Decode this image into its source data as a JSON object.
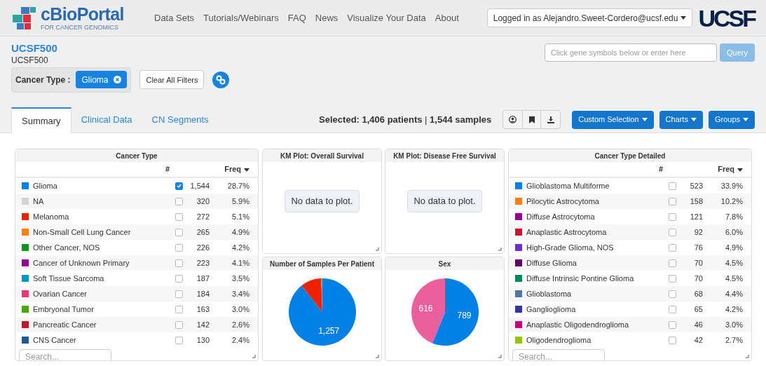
{
  "header": {
    "logo_title": "cBioPortal",
    "logo_subtitle": "FOR CANCER GENOMICS",
    "nav": [
      "Data Sets",
      "Tutorials/Webinars",
      "FAQ",
      "News",
      "Visualize Your Data",
      "About"
    ],
    "login": "Logged in as Alejandro.Sweet-Cordero@ucsf.edu",
    "brand": "UCSF"
  },
  "study": {
    "title": "UCSF500",
    "subtitle": "UCSF500",
    "filter_label": "Cancer Type :",
    "filters": [
      "Glioma"
    ],
    "clear_button": "Clear All Filters",
    "gene_query": {
      "placeholder": "Click gene symbols below or enter here"
    },
    "query_button": "Query"
  },
  "tabs": [
    {
      "label": "Summary",
      "selected": true
    },
    {
      "label": "Clinical Data",
      "selected": false
    },
    {
      "label": "CN Segments",
      "selected": false
    }
  ],
  "selection": {
    "label": "Selected:",
    "patients": "1,406 patients",
    "separator": "|",
    "samples": "1,544 samples"
  },
  "toolbar_buttons": [
    "Custom Selection",
    "Charts",
    "Groups"
  ],
  "tables": [
    {
      "title": "Cancer Type",
      "col_count": "#",
      "col_freq": "Freq",
      "search": {
        "placeholder": "Search..."
      },
      "rows": [
        {
          "name": "Glioma",
          "color": "#0280e6",
          "checked": true,
          "count": "1,544",
          "freq": "28.7%"
        },
        {
          "name": "NA",
          "color": "#d3d3d3",
          "checked": false,
          "count": "320",
          "freq": "5.9%"
        },
        {
          "name": "Melanoma",
          "color": "#ee2200",
          "checked": false,
          "count": "272",
          "freq": "5.1%"
        },
        {
          "name": "Non-Small Cell Lung Cancer",
          "color": "#ff7f0e",
          "checked": false,
          "count": "265",
          "freq": "4.9%"
        },
        {
          "name": "Other Cancer, NOS",
          "color": "#109618",
          "checked": false,
          "count": "226",
          "freq": "4.2%"
        },
        {
          "name": "Cancer of Unknown Primary",
          "color": "#990099",
          "checked": false,
          "count": "223",
          "freq": "4.1%"
        },
        {
          "name": "Soft Tissue Sarcoma",
          "color": "#0099c6",
          "checked": false,
          "count": "187",
          "freq": "3.5%"
        },
        {
          "name": "Ovarian Cancer",
          "color": "#ee3377",
          "checked": false,
          "count": "184",
          "freq": "3.4%"
        },
        {
          "name": "Embryonal Tumor",
          "color": "#44aa00",
          "checked": false,
          "count": "163",
          "freq": "3.0%"
        },
        {
          "name": "Pancreatic Cancer",
          "color": "#c4192a",
          "checked": false,
          "count": "142",
          "freq": "2.6%"
        },
        {
          "name": "CNS Cancer",
          "color": "#1c5c94",
          "checked": false,
          "count": "130",
          "freq": "2.4%"
        }
      ]
    },
    {
      "title": "Cancer Type Detailed",
      "col_count": "#",
      "col_freq": "Freq",
      "search": {
        "placeholder": "Search..."
      },
      "rows": [
        {
          "name": "Glioblastoma Multiforme",
          "color": "#0280e6",
          "checked": false,
          "count": "523",
          "freq": "33.9%"
        },
        {
          "name": "Pilocytic Astrocytoma",
          "color": "#ff7f0e",
          "checked": false,
          "count": "158",
          "freq": "10.2%"
        },
        {
          "name": "Diffuse Astrocytoma",
          "color": "#990099",
          "checked": false,
          "count": "121",
          "freq": "7.8%"
        },
        {
          "name": "Anaplastic Astrocytoma",
          "color": "#c4192a",
          "checked": false,
          "count": "92",
          "freq": "6.0%"
        },
        {
          "name": "High-Grade Glioma, NOS",
          "color": "#6f2fd0",
          "checked": false,
          "count": "76",
          "freq": "4.9%"
        },
        {
          "name": "Diffuse Glioma",
          "color": "#660066",
          "checked": false,
          "count": "70",
          "freq": "4.5%"
        },
        {
          "name": "Diffuse Intrinsic Pontine Glioma",
          "color": "#008855",
          "checked": false,
          "count": "70",
          "freq": "4.5%"
        },
        {
          "name": "Glioblastoma",
          "color": "#5074a8",
          "checked": false,
          "count": "68",
          "freq": "4.4%"
        },
        {
          "name": "Ganglioglioma",
          "color": "#3333aa",
          "checked": false,
          "count": "65",
          "freq": "4.2%"
        },
        {
          "name": "Anaplastic Oligodendroglioma",
          "color": "#cc0080",
          "checked": false,
          "count": "46",
          "freq": "3.0%"
        },
        {
          "name": "Oligodendroglioma",
          "color": "#99c400",
          "checked": false,
          "count": "42",
          "freq": "2.7%"
        }
      ]
    }
  ],
  "km_plots": [
    {
      "title": "KM Plot: Overall Survival",
      "message": "No data to plot."
    },
    {
      "title": "KM Plot: Disease Free Survival",
      "message": "No data to plot."
    }
  ],
  "pie_charts": [
    {
      "title": "Number of Samples Per Patient",
      "chart_data": {
        "type": "pie",
        "series": [
          {
            "values": [
              89.4,
              10.0,
              0.6
            ]
          }
        ],
        "colors": [
          "#0280e6",
          "#ee2200",
          "#ff7f0e"
        ],
        "value_labels": [
          "1,257",
          null,
          null
        ]
      }
    },
    {
      "title": "Sex",
      "chart_data": {
        "type": "pie",
        "series": [
          {
            "values": [
              789,
              616
            ]
          }
        ],
        "colors": [
          "#0280e6",
          "#ea5f9c"
        ],
        "data_labels": true
      }
    }
  ]
}
